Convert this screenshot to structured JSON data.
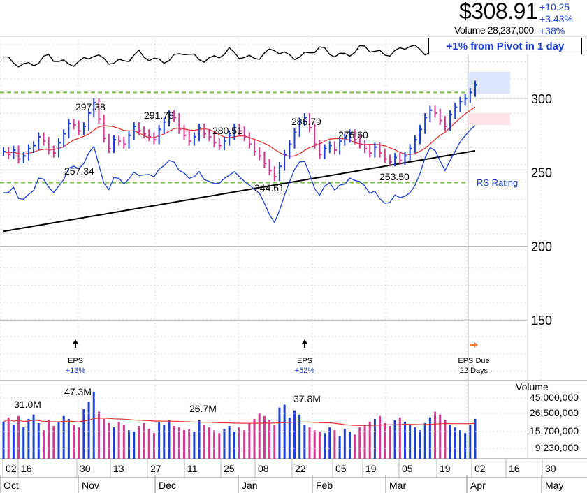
{
  "quote": {
    "price": "$308.91",
    "volume_label": "Volume 28,237,000",
    "change_abs": "+10.25",
    "change_pct": "+3.43%",
    "vol_change": "+38%",
    "pivot_badge": "+1% from Pivot in 1 day"
  },
  "colors": {
    "up": "#1a3fd6",
    "down": "#d0398f",
    "ma_short": "#e3342f",
    "ma_long": "#000000",
    "rs_line": "#1a3fd6",
    "pivot_line": "#7bc143",
    "eps_due_arrow": "#f07b3f"
  },
  "chart_data": {
    "type": "candlestick",
    "price_axis": {
      "ticks": [
        150,
        200,
        250,
        300
      ],
      "range": [
        109,
        342
      ]
    },
    "volume_axis": {
      "label": "Volume",
      "ticks": [
        "45,000,000",
        "26,500,000",
        "15,700,000",
        "9,230,000"
      ]
    },
    "x_axis": {
      "day_ticks": [
        "02",
        "16",
        "30",
        "13",
        "27",
        "11",
        "25",
        "08",
        "22",
        "05",
        "19",
        "05",
        "19",
        "02",
        "16",
        "30"
      ],
      "months": [
        "Oct",
        "Nov",
        "Dec",
        "Jan",
        "Feb",
        "Mar",
        "Apr",
        "May"
      ]
    },
    "price_annotations": [
      "297.38",
      "257.34",
      "291.78",
      "280.51",
      "244.61",
      "286.79",
      "276.60",
      "253.50"
    ],
    "volume_annotations": [
      "31.0M",
      "47.3M",
      "26.7M",
      "37.8M"
    ],
    "pivot_levels": [
      304,
      243
    ],
    "rs_label": "RS Rating",
    "events": [
      {
        "label": "EPS",
        "value": "+13%"
      },
      {
        "label": "EPS",
        "value": "+52%"
      },
      {
        "label": "EPS Due",
        "value": "22 Days"
      }
    ],
    "closes": [
      264,
      262,
      265,
      259,
      261,
      266,
      268,
      274,
      271,
      265,
      263,
      270,
      276,
      283,
      282,
      278,
      281,
      290,
      297,
      286,
      273,
      266,
      272,
      271,
      269,
      275,
      281,
      278,
      276,
      274,
      272,
      279,
      284,
      289,
      287,
      279,
      275,
      271,
      274,
      280,
      276,
      274,
      270,
      268,
      271,
      275,
      280,
      278,
      274,
      269,
      264,
      261,
      256,
      251,
      247,
      254,
      262,
      269,
      277,
      284,
      287,
      280,
      269,
      262,
      266,
      268,
      265,
      271,
      273,
      276,
      272,
      269,
      266,
      263,
      267,
      263,
      259,
      257,
      260,
      258,
      261,
      266,
      272,
      279,
      287,
      292,
      290,
      285,
      281,
      289,
      294,
      298,
      300,
      304,
      309
    ],
    "volumes": [
      26,
      29,
      24,
      30,
      22,
      28,
      31,
      25,
      20,
      27,
      23,
      26,
      30,
      28,
      24,
      22,
      35,
      40,
      47,
      33,
      28,
      25,
      22,
      26,
      24,
      20,
      19,
      23,
      25,
      21,
      18,
      26,
      24,
      27,
      23,
      22,
      20,
      21,
      19,
      27,
      24,
      22,
      20,
      18,
      21,
      23,
      19,
      22,
      20,
      25,
      28,
      32,
      30,
      27,
      24,
      36,
      38,
      29,
      34,
      31,
      24,
      22,
      20,
      19,
      18,
      22,
      20,
      16,
      21,
      19,
      17,
      22,
      24,
      26,
      28,
      30,
      25,
      23,
      27,
      29,
      26,
      24,
      22,
      20,
      25,
      29,
      33,
      31,
      27,
      24,
      22,
      20,
      18,
      24,
      28
    ]
  }
}
